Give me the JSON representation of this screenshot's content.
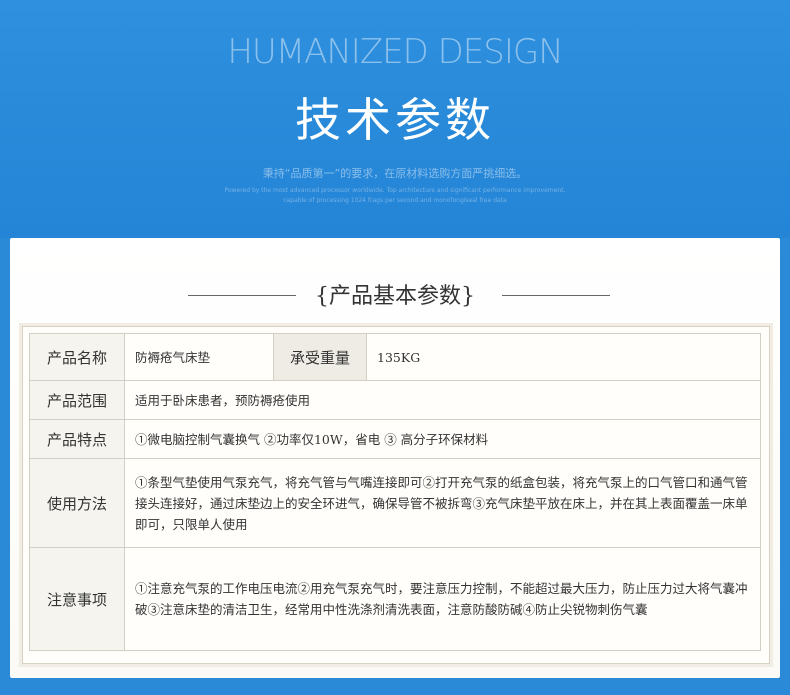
{
  "banner": {
    "heading_en": "HUMANIZED DESIGN",
    "heading_cn": "技术参数",
    "slogan": "秉持“品质第一”的要求，在原材料选购方面严挑细选。",
    "fine_print_1": "Powered by the most advanced processor worldwide. Top architecture and significant performance improvement,",
    "fine_print_2": "capable of processing 1024 frags per second and monofongiseal free data"
  },
  "section": {
    "title": "{产品基本参数}"
  },
  "params": {
    "name_label": "产品名称",
    "name_value": "防褥疮气床垫",
    "load_label": "承受重量",
    "load_value": "135KG",
    "scope_label": "产品范围",
    "scope_value": "适用于卧床患者，预防褥疮使用",
    "features_label": "产品特点",
    "features_value": "①微电脑控制气囊换气 ②功率仅10W，省电 ③ 高分子环保材料",
    "usage_label": "使用方法",
    "usage_value": "①条型气垫使用气泵充气，将充气管与气嘴连接即可②打开充气泵的纸盒包装，将充气泵上的口气管口和通气管接头连接好，通过床垫边上的安全环进气，确保导管不被拆弯③充气床垫平放在床上，并在其上表面覆盖一床单即可，只限单人使用",
    "notes_label": "注意事项",
    "notes_value": "①注意充气泵的工作电压电流②用充气泵充气时，要注意压力控制，不能超过最大压力，防止压力过大将气囊冲破③注意床垫的清洁卫生，经常用中性洗涤剂清洗表面，注意防酸防碱④防止尖锐物刺伤气囊"
  }
}
